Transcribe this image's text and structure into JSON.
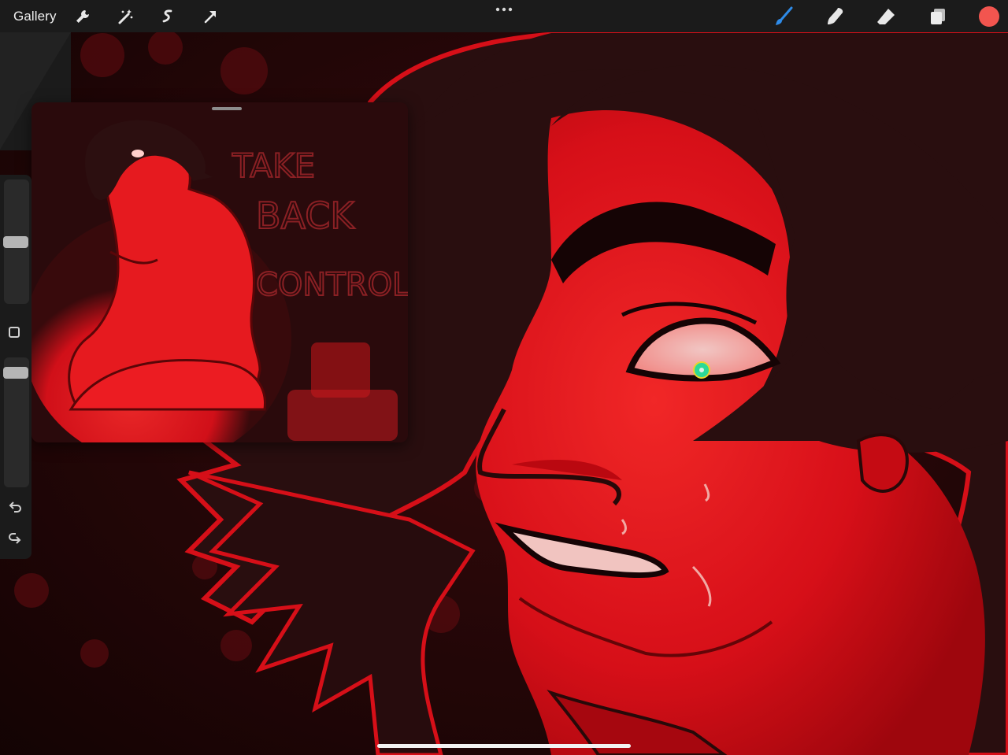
{
  "toolbar": {
    "gallery_label": "Gallery",
    "left_tools": [
      "wrench-icon",
      "magic-wand-icon",
      "selection-icon",
      "transform-arrow-icon"
    ],
    "right_tools": [
      "brush-icon",
      "smudge-icon",
      "eraser-icon",
      "layers-icon"
    ],
    "active_tool": "brush",
    "active_tool_color": "#2e8be8",
    "current_color": "#f2554f"
  },
  "reference": {
    "text_lines": [
      "TAKE",
      "BACK",
      "CONTROL"
    ]
  },
  "sidebar": {
    "brush_size_level": 0.5,
    "opacity_level": 0.92,
    "controls": [
      "brush-size-slider",
      "modify-button",
      "opacity-slider",
      "undo-icon",
      "redo-icon"
    ]
  },
  "colors": {
    "toolbar_bg": "#1b1b1b",
    "canvas_red": "#e3101a",
    "canvas_dark": "#1c0607",
    "eye_dot": "#2fe6a0"
  }
}
